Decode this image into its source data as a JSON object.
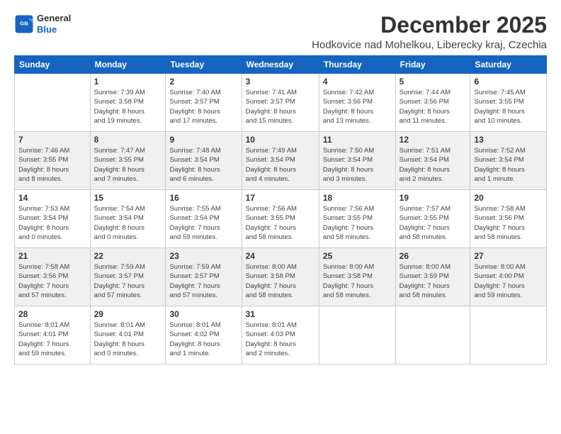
{
  "logo": {
    "line1": "General",
    "line2": "Blue"
  },
  "title": "December 2025",
  "subtitle": "Hodkovice nad Mohelkou, Liberecky kraj, Czechia",
  "header": {
    "days": [
      "Sunday",
      "Monday",
      "Tuesday",
      "Wednesday",
      "Thursday",
      "Friday",
      "Saturday"
    ]
  },
  "weeks": [
    {
      "shaded": false,
      "days": [
        {
          "num": "",
          "info": ""
        },
        {
          "num": "1",
          "info": "Sunrise: 7:39 AM\nSunset: 3:58 PM\nDaylight: 8 hours\nand 19 minutes."
        },
        {
          "num": "2",
          "info": "Sunrise: 7:40 AM\nSunset: 3:57 PM\nDaylight: 8 hours\nand 17 minutes."
        },
        {
          "num": "3",
          "info": "Sunrise: 7:41 AM\nSunset: 3:57 PM\nDaylight: 8 hours\nand 15 minutes."
        },
        {
          "num": "4",
          "info": "Sunrise: 7:42 AM\nSunset: 3:56 PM\nDaylight: 8 hours\nand 13 minutes."
        },
        {
          "num": "5",
          "info": "Sunrise: 7:44 AM\nSunset: 3:56 PM\nDaylight: 8 hours\nand 11 minutes."
        },
        {
          "num": "6",
          "info": "Sunrise: 7:45 AM\nSunset: 3:55 PM\nDaylight: 8 hours\nand 10 minutes."
        }
      ]
    },
    {
      "shaded": true,
      "days": [
        {
          "num": "7",
          "info": "Sunrise: 7:46 AM\nSunset: 3:55 PM\nDaylight: 8 hours\nand 8 minutes."
        },
        {
          "num": "8",
          "info": "Sunrise: 7:47 AM\nSunset: 3:55 PM\nDaylight: 8 hours\nand 7 minutes."
        },
        {
          "num": "9",
          "info": "Sunrise: 7:48 AM\nSunset: 3:54 PM\nDaylight: 8 hours\nand 6 minutes."
        },
        {
          "num": "10",
          "info": "Sunrise: 7:49 AM\nSunset: 3:54 PM\nDaylight: 8 hours\nand 4 minutes."
        },
        {
          "num": "11",
          "info": "Sunrise: 7:50 AM\nSunset: 3:54 PM\nDaylight: 8 hours\nand 3 minutes."
        },
        {
          "num": "12",
          "info": "Sunrise: 7:51 AM\nSunset: 3:54 PM\nDaylight: 8 hours\nand 2 minutes."
        },
        {
          "num": "13",
          "info": "Sunrise: 7:52 AM\nSunset: 3:54 PM\nDaylight: 8 hours\nand 1 minute."
        }
      ]
    },
    {
      "shaded": false,
      "days": [
        {
          "num": "14",
          "info": "Sunrise: 7:53 AM\nSunset: 3:54 PM\nDaylight: 8 hours\nand 0 minutes."
        },
        {
          "num": "15",
          "info": "Sunrise: 7:54 AM\nSunset: 3:54 PM\nDaylight: 8 hours\nand 0 minutes."
        },
        {
          "num": "16",
          "info": "Sunrise: 7:55 AM\nSunset: 3:54 PM\nDaylight: 7 hours\nand 59 minutes."
        },
        {
          "num": "17",
          "info": "Sunrise: 7:56 AM\nSunset: 3:55 PM\nDaylight: 7 hours\nand 58 minutes."
        },
        {
          "num": "18",
          "info": "Sunrise: 7:56 AM\nSunset: 3:55 PM\nDaylight: 7 hours\nand 58 minutes."
        },
        {
          "num": "19",
          "info": "Sunrise: 7:57 AM\nSunset: 3:55 PM\nDaylight: 7 hours\nand 58 minutes."
        },
        {
          "num": "20",
          "info": "Sunrise: 7:58 AM\nSunset: 3:56 PM\nDaylight: 7 hours\nand 58 minutes."
        }
      ]
    },
    {
      "shaded": true,
      "days": [
        {
          "num": "21",
          "info": "Sunrise: 7:58 AM\nSunset: 3:56 PM\nDaylight: 7 hours\nand 57 minutes."
        },
        {
          "num": "22",
          "info": "Sunrise: 7:59 AM\nSunset: 3:57 PM\nDaylight: 7 hours\nand 57 minutes."
        },
        {
          "num": "23",
          "info": "Sunrise: 7:59 AM\nSunset: 3:57 PM\nDaylight: 7 hours\nand 57 minutes."
        },
        {
          "num": "24",
          "info": "Sunrise: 8:00 AM\nSunset: 3:58 PM\nDaylight: 7 hours\nand 58 minutes."
        },
        {
          "num": "25",
          "info": "Sunrise: 8:00 AM\nSunset: 3:58 PM\nDaylight: 7 hours\nand 58 minutes."
        },
        {
          "num": "26",
          "info": "Sunrise: 8:00 AM\nSunset: 3:59 PM\nDaylight: 7 hours\nand 58 minutes."
        },
        {
          "num": "27",
          "info": "Sunrise: 8:00 AM\nSunset: 4:00 PM\nDaylight: 7 hours\nand 59 minutes."
        }
      ]
    },
    {
      "shaded": false,
      "days": [
        {
          "num": "28",
          "info": "Sunrise: 8:01 AM\nSunset: 4:01 PM\nDaylight: 7 hours\nand 59 minutes."
        },
        {
          "num": "29",
          "info": "Sunrise: 8:01 AM\nSunset: 4:01 PM\nDaylight: 8 hours\nand 0 minutes."
        },
        {
          "num": "30",
          "info": "Sunrise: 8:01 AM\nSunset: 4:02 PM\nDaylight: 8 hours\nand 1 minute."
        },
        {
          "num": "31",
          "info": "Sunrise: 8:01 AM\nSunset: 4:03 PM\nDaylight: 8 hours\nand 2 minutes."
        },
        {
          "num": "",
          "info": ""
        },
        {
          "num": "",
          "info": ""
        },
        {
          "num": "",
          "info": ""
        }
      ]
    }
  ]
}
